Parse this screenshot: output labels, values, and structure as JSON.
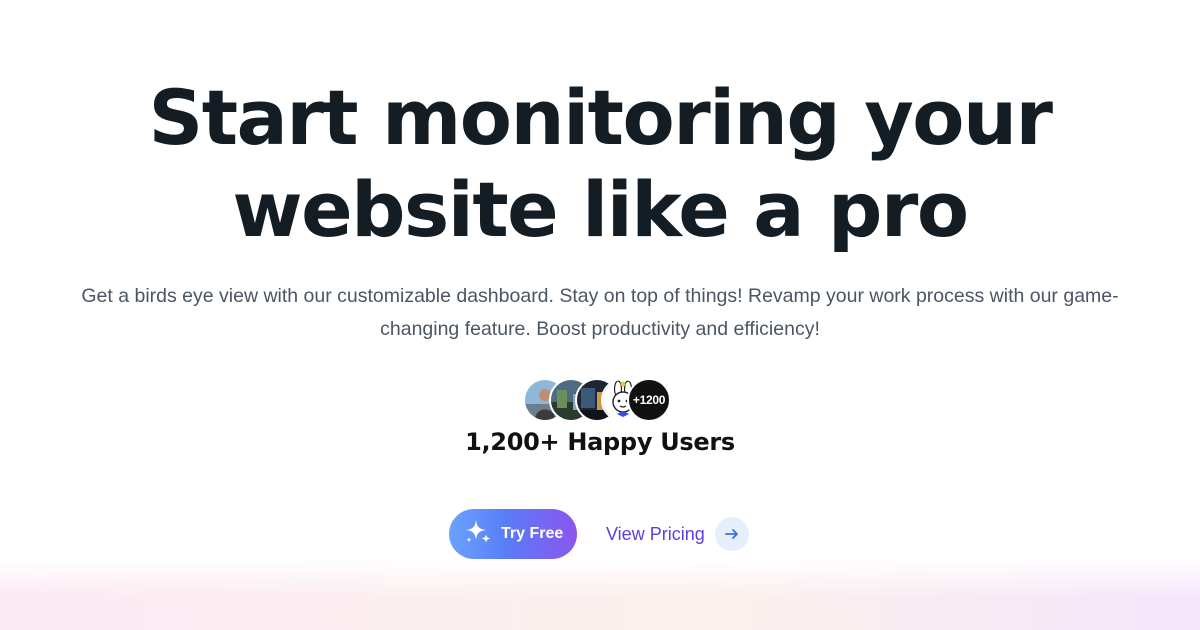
{
  "hero": {
    "title_line1": "Start monitoring your",
    "title_line2": "website like a pro",
    "subtitle": "Get a birds eye view with our customizable dashboard. Stay on top of things! Revamp your work process with our game-changing feature. Boost productivity and efficiency!"
  },
  "social_proof": {
    "avatar_icons": [
      "user-avatar-1",
      "user-avatar-2",
      "user-avatar-3",
      "bunny-avatar-icon"
    ],
    "extra_count": "+1200",
    "label": "1,200+ Happy Users"
  },
  "actions": {
    "primary_label": "Try Free",
    "primary_icon": "sparkles-icon",
    "secondary_label": "View Pricing",
    "secondary_icon": "arrow-right-icon"
  },
  "colors": {
    "title": "#141c24",
    "subtitle": "#4b5664",
    "accent_purple": "#5b3fe0",
    "button_gradient_start": "#6aa3ff",
    "button_gradient_end": "#8b55ee"
  }
}
